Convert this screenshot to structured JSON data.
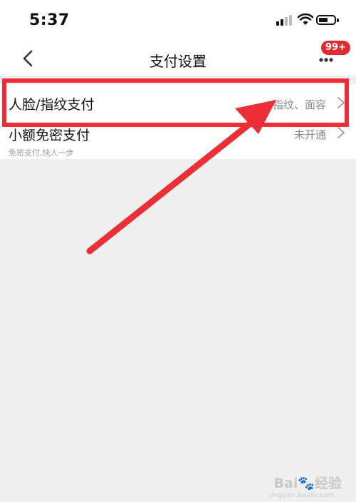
{
  "status_bar": {
    "time": "5:37"
  },
  "nav": {
    "title": "支付设置",
    "badge": "99+"
  },
  "settings": [
    {
      "title": "人脸/指纹支付",
      "value": "指纹、面容"
    },
    {
      "title": "小额免密支付",
      "subtitle": "免密支付,快人一步",
      "value": "未开通"
    }
  ],
  "annotation": {
    "color": "#ec2f36"
  },
  "watermark": {
    "text": "Bai🐾经验",
    "url": "jingyan.baidu.com"
  }
}
